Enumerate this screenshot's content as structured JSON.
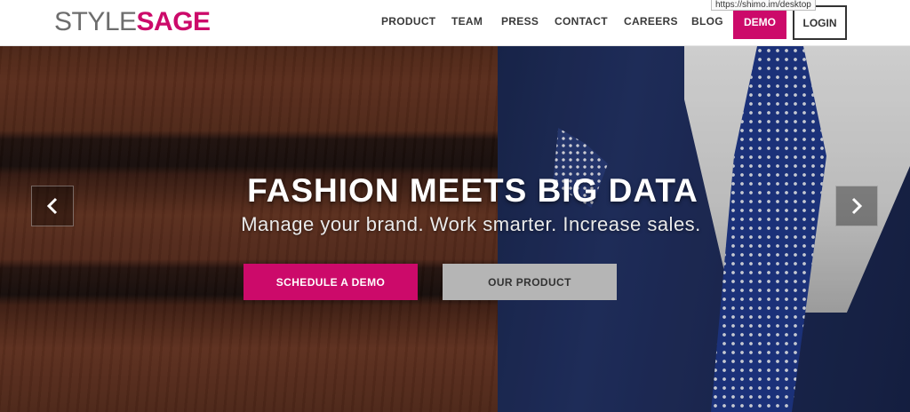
{
  "header": {
    "logo": {
      "part1": "STYLE",
      "part2": "SAGE"
    },
    "nav": [
      {
        "label": "PRODUCT"
      },
      {
        "label": "TEAM"
      },
      {
        "label": "PRESS"
      },
      {
        "label": "CONTACT"
      },
      {
        "label": "CAREERS"
      },
      {
        "label": "BLOG"
      }
    ],
    "demo_label": "DEMO",
    "login_label": "LOGIN",
    "url_tooltip": "https://shimo.im/desktop"
  },
  "hero": {
    "title": "FASHION MEETS BIG DATA",
    "subtitle": "Manage your brand. Work smarter. Increase sales.",
    "primary_cta": "SCHEDULE A DEMO",
    "secondary_cta": "OUR PRODUCT",
    "prev_icon": "chevron-left-icon",
    "next_icon": "chevron-right-icon"
  },
  "colors": {
    "brand": "#cc0a6a",
    "secondary_button": "#b5b5b5"
  }
}
